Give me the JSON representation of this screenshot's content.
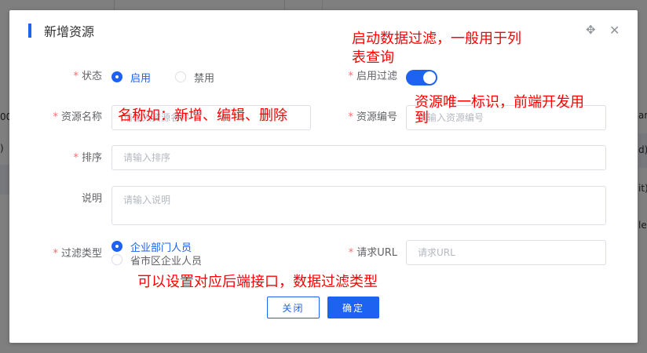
{
  "dialog": {
    "title": "新增资源"
  },
  "form": {
    "status": {
      "label": "状态",
      "options": [
        "启用",
        "禁用"
      ],
      "selected": "启用"
    },
    "filter_enabled": {
      "label": "启用过滤",
      "value": true
    },
    "resource_name": {
      "label": "资源名称",
      "placeholder": "请输入资源名称",
      "value": ""
    },
    "resource_code": {
      "label": "资源编号",
      "placeholder": "请输入资源编号",
      "value": ""
    },
    "sort": {
      "label": "排序",
      "placeholder": "请输入排序",
      "value": ""
    },
    "description": {
      "label": "说明",
      "placeholder": "请输入说明",
      "value": ""
    },
    "filter_type": {
      "label": "过滤类型",
      "options": [
        "企业部门人员",
        "省市区企业人员"
      ],
      "selected": "企业部门人员"
    },
    "request_url": {
      "label": "请求URL",
      "placeholder": "请求URL",
      "value": ""
    }
  },
  "buttons": {
    "close": "关闭",
    "confirm": "确定"
  },
  "annotations": {
    "filter_note_line1": "启动数据过滤，一般用于列",
    "filter_note_line2": "表查询",
    "name_note": "名称如：新增、编辑、删除",
    "code_note_line1": "资源唯一标识，前端开发用",
    "code_note_line2": "到",
    "filter_type_note": "可以设置对应后端接口，数据过滤类型"
  },
  "background": {
    "left_text_1": "00",
    "left_text_2": ")",
    "right_text_1": "are",
    "right_text_2": "d)",
    "right_text_3": "it)",
    "right_text_4": "le"
  },
  "colors": {
    "primary": "#1d62f0",
    "required": "#f56c6c",
    "annotation": "#ff0000"
  }
}
